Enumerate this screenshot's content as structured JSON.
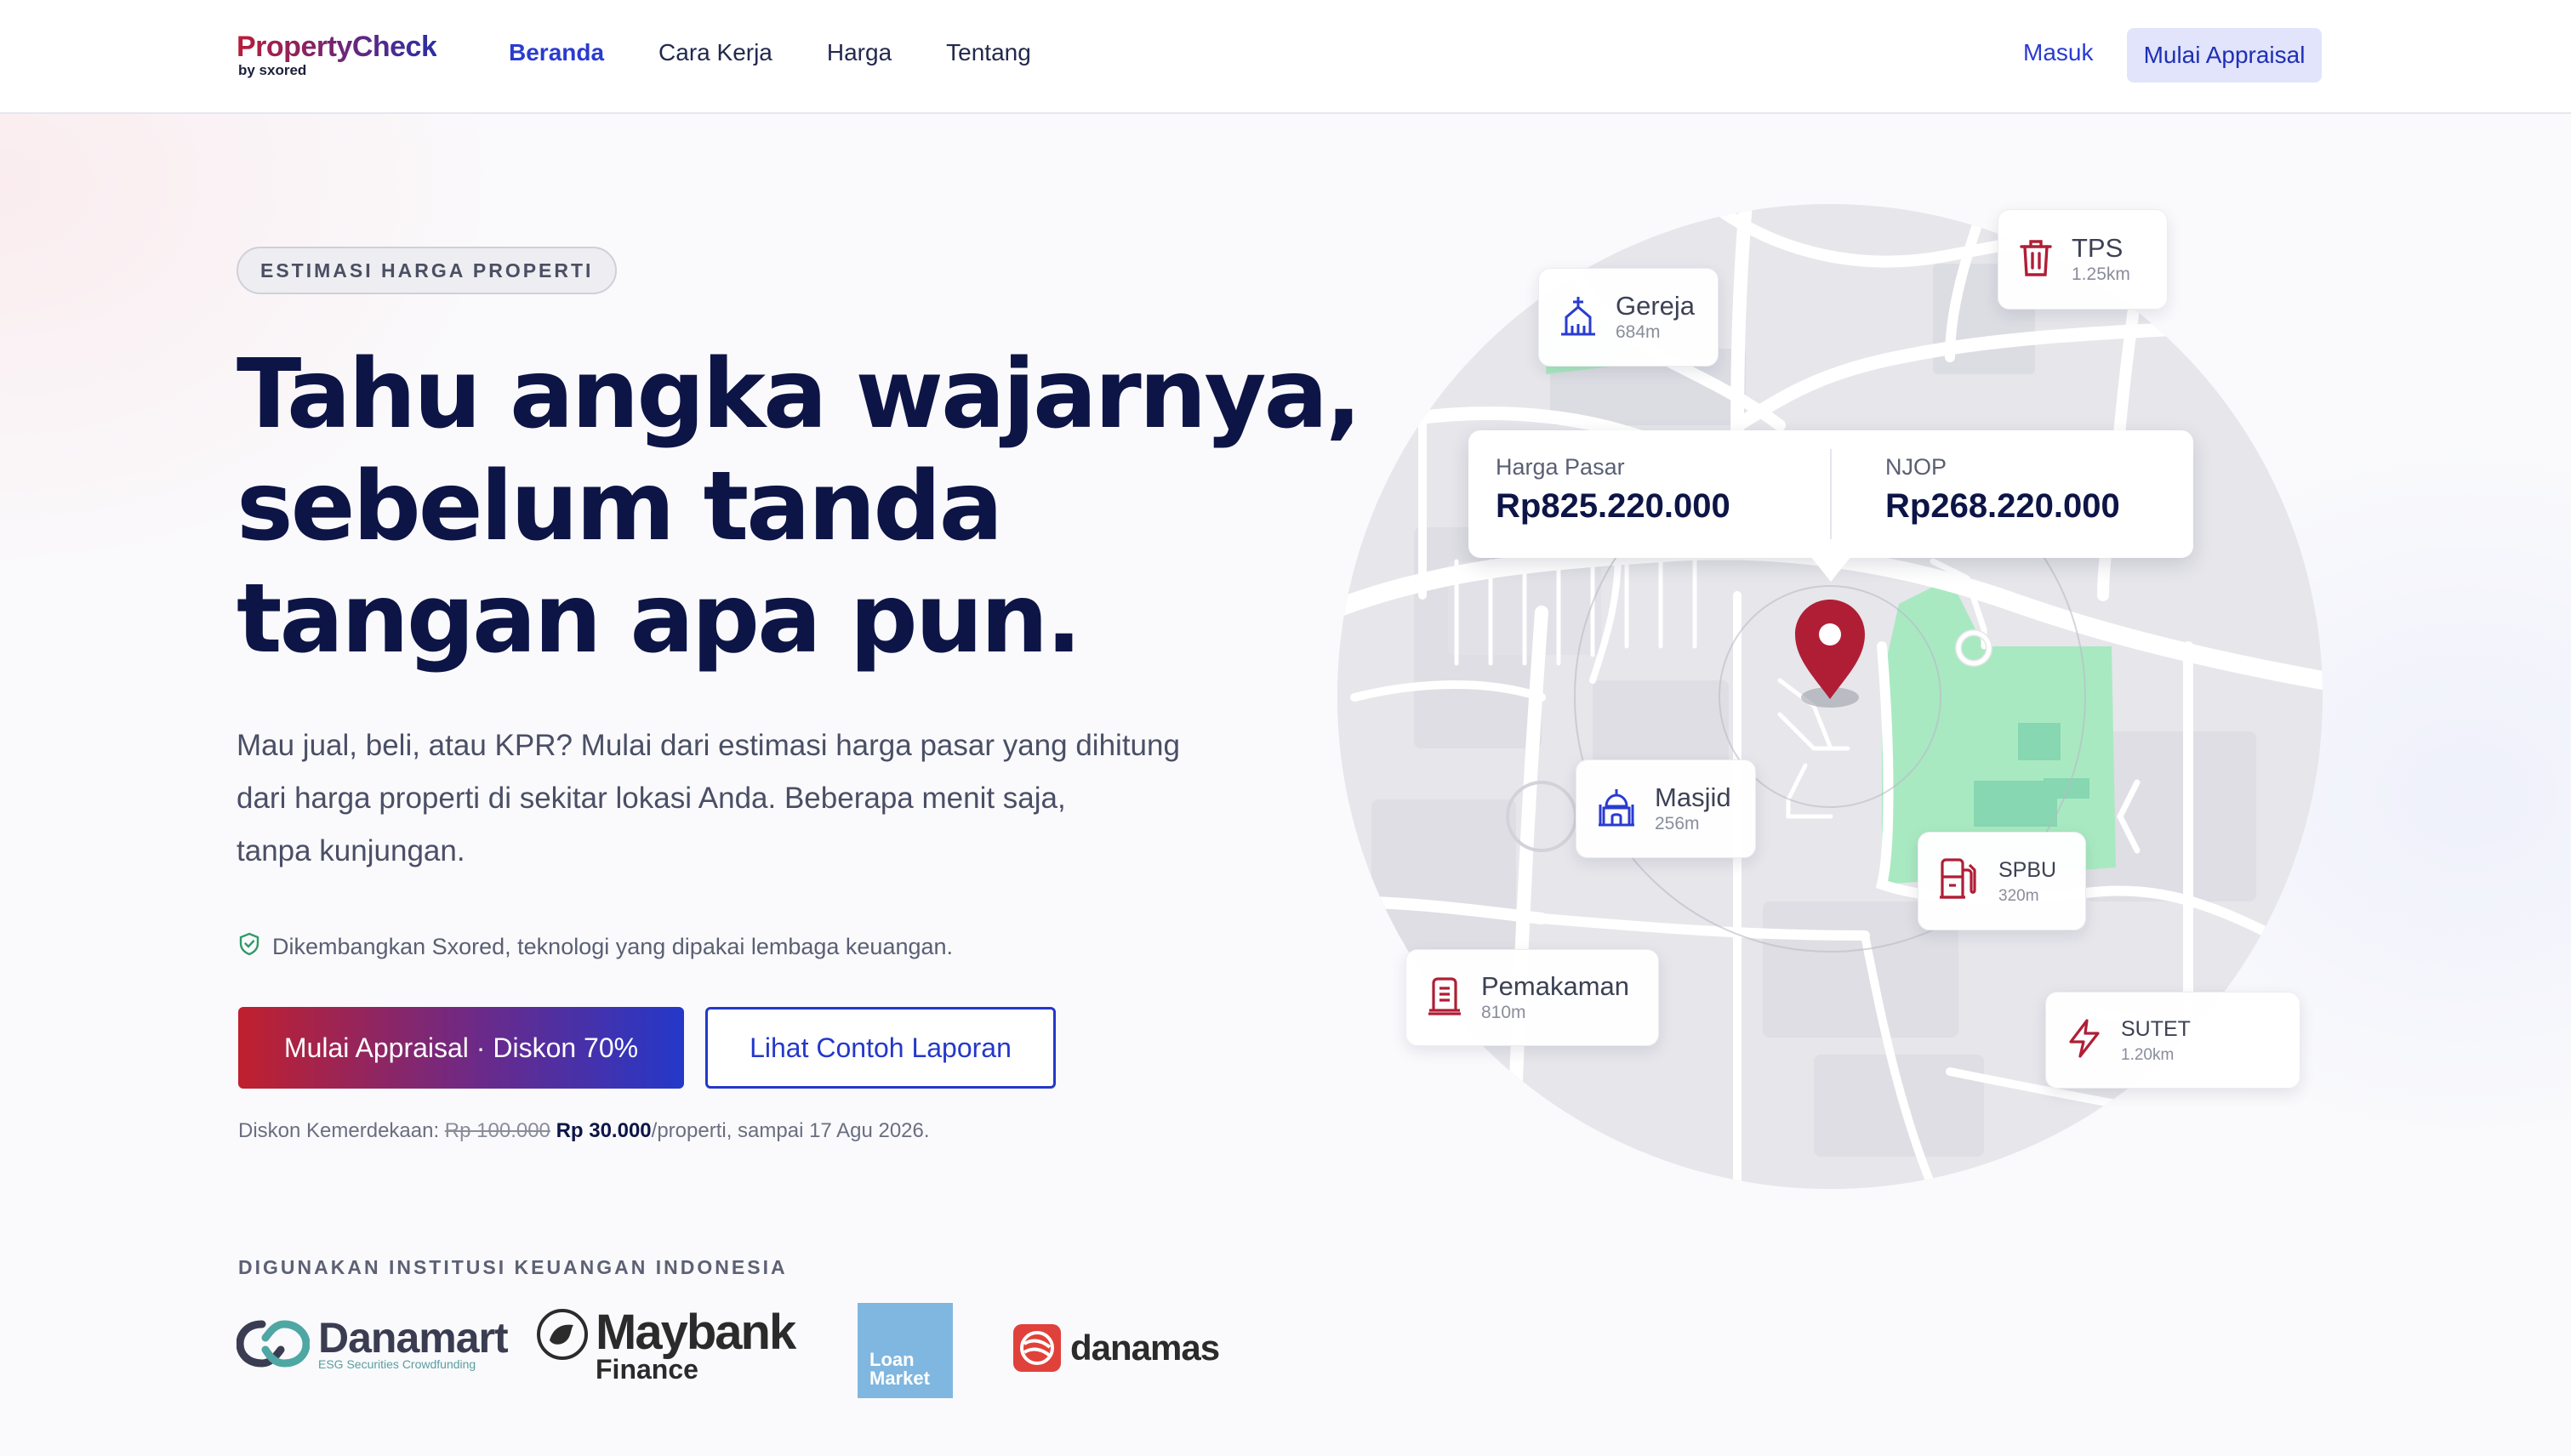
{
  "nav": {
    "logo": "PropertyCheck",
    "logo_sub": "by sxored",
    "links": [
      "Beranda",
      "Cara Kerja",
      "Harga",
      "Tentang"
    ],
    "login": "Masuk",
    "cta": "Mulai Appraisal"
  },
  "hero": {
    "badge": "ESTIMASI HARGA PROPERTI",
    "headline": [
      "Tahu angka wajarnya,",
      "sebelum tanda",
      "tangan apa pun."
    ],
    "subtitle": [
      "Mau jual, beli, atau KPR? Mulai dari estimasi harga pasar yang dihitung",
      "dari harga properti di sekitar lokasi Anda. Beberapa menit saja,",
      "tanpa kunjungan."
    ],
    "trust": "Dikembangkan Sxored, teknologi yang dipakai lembaga keuangan.",
    "primary_button": "Mulai Appraisal · Diskon 70%",
    "secondary_button": "Lihat Contoh Laporan",
    "discount": {
      "prefix": "Diskon Kemerdekaan: ",
      "old_price": "Rp 100.000",
      "new_price": "Rp 30.000",
      "suffix": "/properti, sampai 17 Agu 2026."
    }
  },
  "institutions": {
    "title": "DIGUNAKAN INSTITUSI KEUANGAN INDONESIA",
    "logos": {
      "danamart": {
        "name": "Danamart",
        "tagline": "ESG Securities Crowdfunding"
      },
      "maybank": {
        "name": "Maybank",
        "sub": "Finance"
      },
      "loanmarket": {
        "line1": "Loan",
        "line2": "Market"
      },
      "danamas": {
        "name": "danamas"
      }
    }
  },
  "map": {
    "prices": {
      "market_label": "Harga Pasar",
      "market_value": "Rp825.220.000",
      "njop_label": "NJOP",
      "njop_value": "Rp268.220.000"
    },
    "pois": {
      "gereja": {
        "name": "Gereja",
        "distance": "684m",
        "icon": "church-icon"
      },
      "tps": {
        "name": "TPS",
        "distance": "1.25km",
        "icon": "trash-icon"
      },
      "masjid": {
        "name": "Masjid",
        "distance": "256m",
        "icon": "mosque-icon"
      },
      "spbu": {
        "name": "SPBU",
        "distance": "320m",
        "icon": "fuel-icon"
      },
      "pemakaman": {
        "name": "Pemakaman",
        "distance": "810m",
        "icon": "grave-icon"
      },
      "sutet": {
        "name": "SUTET",
        "distance": "1.20km",
        "icon": "lightning-icon"
      }
    }
  },
  "colors": {
    "primary": "#2a3bd0",
    "navy": "#0d1547",
    "red": "#b01e35",
    "green_area": "#a9e9c2"
  }
}
